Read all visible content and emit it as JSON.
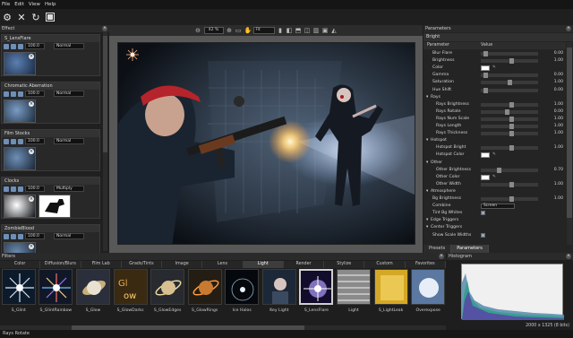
{
  "menu": [
    "File",
    "Edit",
    "View",
    "Help"
  ],
  "effect_panel": {
    "title": "Effect",
    "cards": [
      {
        "name": "S_LensFlare",
        "opacity": "100.0",
        "blend": "Normal"
      },
      {
        "name": "Chromatic Aberration",
        "opacity": "100.0",
        "blend": "Normal"
      },
      {
        "name": "Film Stocks",
        "opacity": "100.0",
        "blend": "Normal"
      },
      {
        "name": "Clocks",
        "opacity": "100.0",
        "blend": "Multiply"
      },
      {
        "name": "ZombieBlood",
        "opacity": "100.0",
        "blend": "Normal"
      }
    ]
  },
  "canvas": {
    "zoom": "42 %",
    "fit": "Fit"
  },
  "parameters": {
    "panel_title": "Parameters",
    "effect_name": "Bright",
    "col_param": "Parameter",
    "col_value": "Value",
    "rows": [
      {
        "label": "Blur Flare",
        "kind": "slider",
        "pos": 0.05,
        "value": "0.00",
        "indent": 1
      },
      {
        "label": "Brightness",
        "kind": "slider",
        "pos": 0.55,
        "value": "1.00",
        "indent": 1
      },
      {
        "label": "Color",
        "kind": "swatch",
        "value": "",
        "indent": 1
      },
      {
        "label": "Gamma",
        "kind": "slider",
        "pos": 0.05,
        "value": "0.00",
        "indent": 1
      },
      {
        "label": "Saturation",
        "kind": "slider",
        "pos": 0.5,
        "value": "1.00",
        "indent": 1
      },
      {
        "label": "Hue Shift",
        "kind": "slider",
        "pos": 0.05,
        "value": "0.00",
        "indent": 1
      },
      {
        "label": "Rays",
        "kind": "group",
        "value": "",
        "indent": 0
      },
      {
        "label": "Rays Brightness",
        "kind": "slider",
        "pos": 0.55,
        "value": "1.00",
        "indent": 2
      },
      {
        "label": "Rays Rotate",
        "kind": "slider",
        "pos": 0.45,
        "value": "0.00",
        "indent": 2
      },
      {
        "label": "Rays Num Scale",
        "kind": "slider",
        "pos": 0.55,
        "value": "1.00",
        "indent": 2
      },
      {
        "label": "Rays Length",
        "kind": "slider",
        "pos": 0.55,
        "value": "1.00",
        "indent": 2
      },
      {
        "label": "Rays Thickness",
        "kind": "slider",
        "pos": 0.55,
        "value": "1.00",
        "indent": 2
      },
      {
        "label": "Hotspot",
        "kind": "group",
        "value": "",
        "indent": 0
      },
      {
        "label": "Hotspot Bright",
        "kind": "slider",
        "pos": 0.55,
        "value": "1.00",
        "indent": 2
      },
      {
        "label": "Hotspot Color",
        "kind": "swatch",
        "value": "",
        "indent": 2
      },
      {
        "label": "Other",
        "kind": "group",
        "value": "",
        "indent": 0
      },
      {
        "label": "Other Brightness",
        "kind": "slider",
        "pos": 0.3,
        "value": "0.70",
        "indent": 2
      },
      {
        "label": "Other Color",
        "kind": "swatch",
        "value": "",
        "indent": 2
      },
      {
        "label": "Other Width",
        "kind": "slider",
        "pos": 0.55,
        "value": "1.00",
        "indent": 2
      },
      {
        "label": "Atmosphere",
        "kind": "group",
        "value": "",
        "indent": 0
      },
      {
        "label": "Bg Brightness",
        "kind": "slider",
        "pos": 0.55,
        "value": "1.00",
        "indent": 1
      },
      {
        "label": "Combine",
        "kind": "dropdown",
        "value": "Screen",
        "indent": 1
      },
      {
        "label": "Tint Bg Whites",
        "kind": "check",
        "value": "",
        "indent": 1
      },
      {
        "label": "Edge Triggers",
        "kind": "group",
        "value": "",
        "indent": 0
      },
      {
        "label": "Center Triggers",
        "kind": "group",
        "value": "",
        "indent": 0
      },
      {
        "label": "Show Scale Widths",
        "kind": "check",
        "value": "",
        "indent": 1
      }
    ],
    "tabs": [
      "Presets",
      "Parameters"
    ],
    "active_tab": "Parameters"
  },
  "filters": {
    "title": "Filters",
    "tabs": [
      "Color",
      "Diffusion/Blurs",
      "Film Lab",
      "Grads/Tints",
      "Image",
      "Lens",
      "Light",
      "Render",
      "Stylize",
      "Custom",
      "Favorites"
    ],
    "active_tab": "Light",
    "items": [
      {
        "label": "S_Glint",
        "theme": "glint",
        "selected": false
      },
      {
        "label": "S_GlintRainbow",
        "theme": "glintrainbow",
        "selected": false
      },
      {
        "label": "S_Glow",
        "theme": "glow",
        "selected": false
      },
      {
        "label": "S_GlowDarks",
        "theme": "glowdarks",
        "selected": false
      },
      {
        "label": "S_GlowEdges",
        "theme": "glowedges",
        "selected": false
      },
      {
        "label": "S_GlowRings",
        "theme": "glowrings",
        "selected": false
      },
      {
        "label": "Ice Halos",
        "theme": "icehalos",
        "selected": false
      },
      {
        "label": "Key Light",
        "theme": "keylight",
        "selected": false
      },
      {
        "label": "S_LensFlare",
        "theme": "lensflare",
        "selected": true
      },
      {
        "label": "Light",
        "theme": "light",
        "selected": false
      },
      {
        "label": "S_LightLeak",
        "theme": "lightleak",
        "selected": false
      },
      {
        "label": "Overexpose",
        "theme": "overexpose",
        "selected": false
      }
    ]
  },
  "histogram": {
    "title": "Histogram",
    "image_size": "2000 x 1325 (8 bits)"
  },
  "status": "Rays Rotate"
}
